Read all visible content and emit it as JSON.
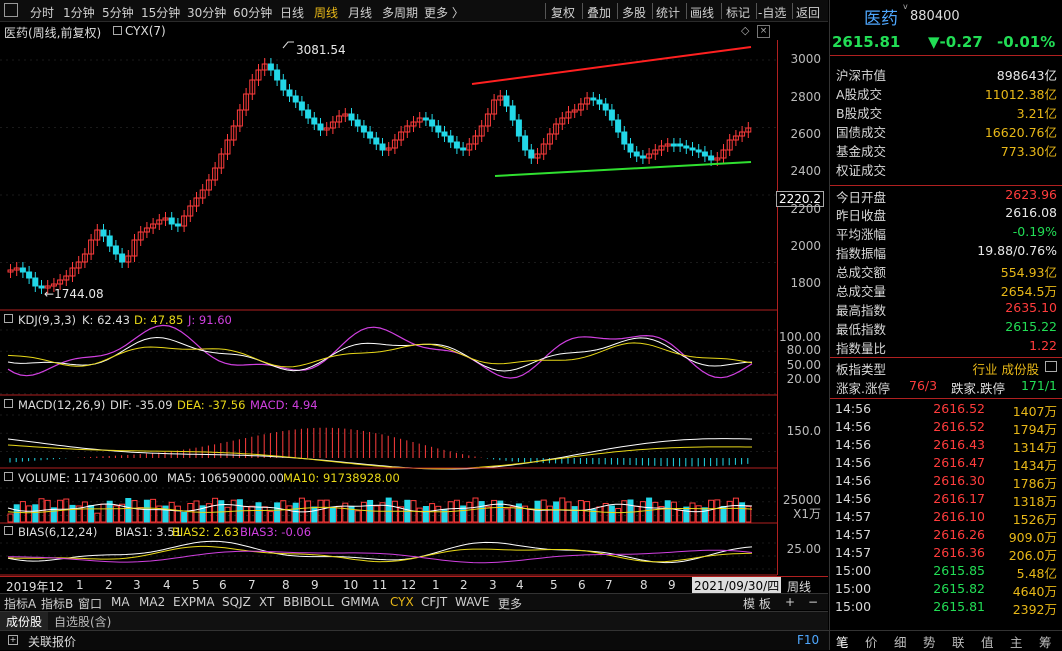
{
  "toolbar": {
    "left_items": [
      "分时",
      "1分钟",
      "5分钟",
      "15分钟",
      "30分钟",
      "60分钟",
      "日线",
      "周线",
      "月线",
      "多周期",
      "更多 〉"
    ],
    "active": "周线",
    "right_items": [
      "复权",
      "叠加",
      "多股",
      "统计",
      "画线",
      "标记",
      "-自选",
      "返回"
    ]
  },
  "chart_header": {
    "name": "医药(周线,前复权)",
    "indicator": "CYX(7)"
  },
  "price_annotations": {
    "high": "3081.54",
    "low": "1744.08",
    "current_tag": "2220.2"
  },
  "price_axis": [
    "3000",
    "2800",
    "2600",
    "2400",
    "2200",
    "2000",
    "1800"
  ],
  "kdj": {
    "label": "KDJ(9,3,3)",
    "k": "K: 62.43",
    "d": "D: 47.85",
    "j": "J: 91.60",
    "axis": [
      "100.00",
      "80.00",
      "50.00",
      "20.00"
    ]
  },
  "macd": {
    "label": "MACD(12,26,9)",
    "dif": "DIF: -35.09",
    "dea": "DEA: -37.56",
    "macd": "MACD: 4.94",
    "axis": [
      "150.0"
    ]
  },
  "volume": {
    "label": "VOLUME: 117430600.00",
    "ma5": "MA5: 106590000.00",
    "ma10": "MA10: 91738928.00",
    "axis": [
      "25000"
    ],
    "unit": "X1万"
  },
  "bias": {
    "label": "BIAS(6,12,24)",
    "b1": "BIAS1: 3.51",
    "b2": "BIAS2: 2.63",
    "b3": "BIAS3: -0.06",
    "axis": [
      "25.00"
    ]
  },
  "time_axis": {
    "labels": [
      "2019年12",
      "1",
      "2",
      "3",
      "4",
      "5",
      "6",
      "7",
      "8",
      "9",
      "10",
      "11",
      "12",
      "1",
      "2",
      "3",
      "4",
      "5",
      "6",
      "7",
      "8",
      "9"
    ],
    "cursor": "2021/09/30/四",
    "period": "周线"
  },
  "indicator_tabs": [
    "指标A",
    "指标B",
    "窗口",
    "MA",
    "MA2",
    "EXPMA",
    "SQJZ",
    "XT",
    "BBIBOLL",
    "GMMA",
    "CYX",
    "CFJT",
    "WAVE",
    "更多"
  ],
  "indicator_active": "CYX",
  "template_label": "模 板",
  "sheet_tabs": [
    "成份股",
    "自选股(含)"
  ],
  "status": {
    "label": "关联报价",
    "f10": "F10"
  },
  "quote": {
    "name": "医药",
    "code": "880400",
    "price": "2615.81",
    "change": "▼-0.27",
    "change_pct": "-0.01%",
    "rows": [
      {
        "l": "沪深市值",
        "r": "898643亿",
        "c": "white"
      },
      {
        "l": "A股成交",
        "r": "11012.38亿",
        "c": "yellow"
      },
      {
        "l": "B股成交",
        "r": "3.21亿",
        "c": "yellow"
      },
      {
        "l": "国债成交",
        "r": "16620.76亿",
        "c": "yellow"
      },
      {
        "l": "基金成交",
        "r": "773.30亿",
        "c": "yellow"
      },
      {
        "l": "权证成交",
        "r": "",
        "c": "yellow"
      },
      {
        "l": "今日开盘",
        "r": "2623.96",
        "c": "red"
      },
      {
        "l": "昨日收盘",
        "r": "2616.08",
        "c": "white"
      },
      {
        "l": "平均涨幅",
        "r": "-0.19%",
        "c": "green"
      },
      {
        "l": "指数振幅",
        "r": "19.88/0.76%",
        "c": "white"
      },
      {
        "l": "总成交额",
        "r": "554.93亿",
        "c": "yellow"
      },
      {
        "l": "总成交量",
        "r": "2654.5万",
        "c": "yellow"
      },
      {
        "l": "最高指数",
        "r": "2635.10",
        "c": "red"
      },
      {
        "l": "最低指数",
        "r": "2615.22",
        "c": "green"
      },
      {
        "l": "指数量比",
        "r": "1.22",
        "c": "red"
      }
    ],
    "board_type_label": "板指类型",
    "board_type_value": "行业 成份股",
    "up_label": "涨家.涨停",
    "up_value": "76/3",
    "down_label": "跌家.跌停",
    "down_value": "171/1"
  },
  "ticks": [
    {
      "t": "14:56",
      "p": "2616.52",
      "v": "1407万",
      "c": "red"
    },
    {
      "t": "14:56",
      "p": "2616.52",
      "v": "1794万",
      "c": "red"
    },
    {
      "t": "14:56",
      "p": "2616.43",
      "v": "1314万",
      "c": "red"
    },
    {
      "t": "14:56",
      "p": "2616.47",
      "v": "1434万",
      "c": "red"
    },
    {
      "t": "14:56",
      "p": "2616.30",
      "v": "1786万",
      "c": "red"
    },
    {
      "t": "14:56",
      "p": "2616.17",
      "v": "1318万",
      "c": "red"
    },
    {
      "t": "14:57",
      "p": "2616.10",
      "v": "1526万",
      "c": "red"
    },
    {
      "t": "14:57",
      "p": "2616.26",
      "v": "909.0万",
      "c": "red"
    },
    {
      "t": "14:57",
      "p": "2616.36",
      "v": "206.0万",
      "c": "red"
    },
    {
      "t": "15:00",
      "p": "2615.85",
      "v": "5.48亿",
      "c": "green"
    },
    {
      "t": "15:00",
      "p": "2615.82",
      "v": "4640万",
      "c": "green"
    },
    {
      "t": "15:00",
      "p": "2615.81",
      "v": "2392万",
      "c": "green"
    }
  ],
  "bottom_tabs": [
    "笔",
    "价",
    "细",
    "势",
    "联",
    "值",
    "主",
    "筹"
  ],
  "colors": {
    "up": "#ff3c3c",
    "down": "#22d8e8",
    "trend_upper": "#ff2020",
    "trend_lower": "#30e030",
    "panel_border": "#b02020"
  }
}
